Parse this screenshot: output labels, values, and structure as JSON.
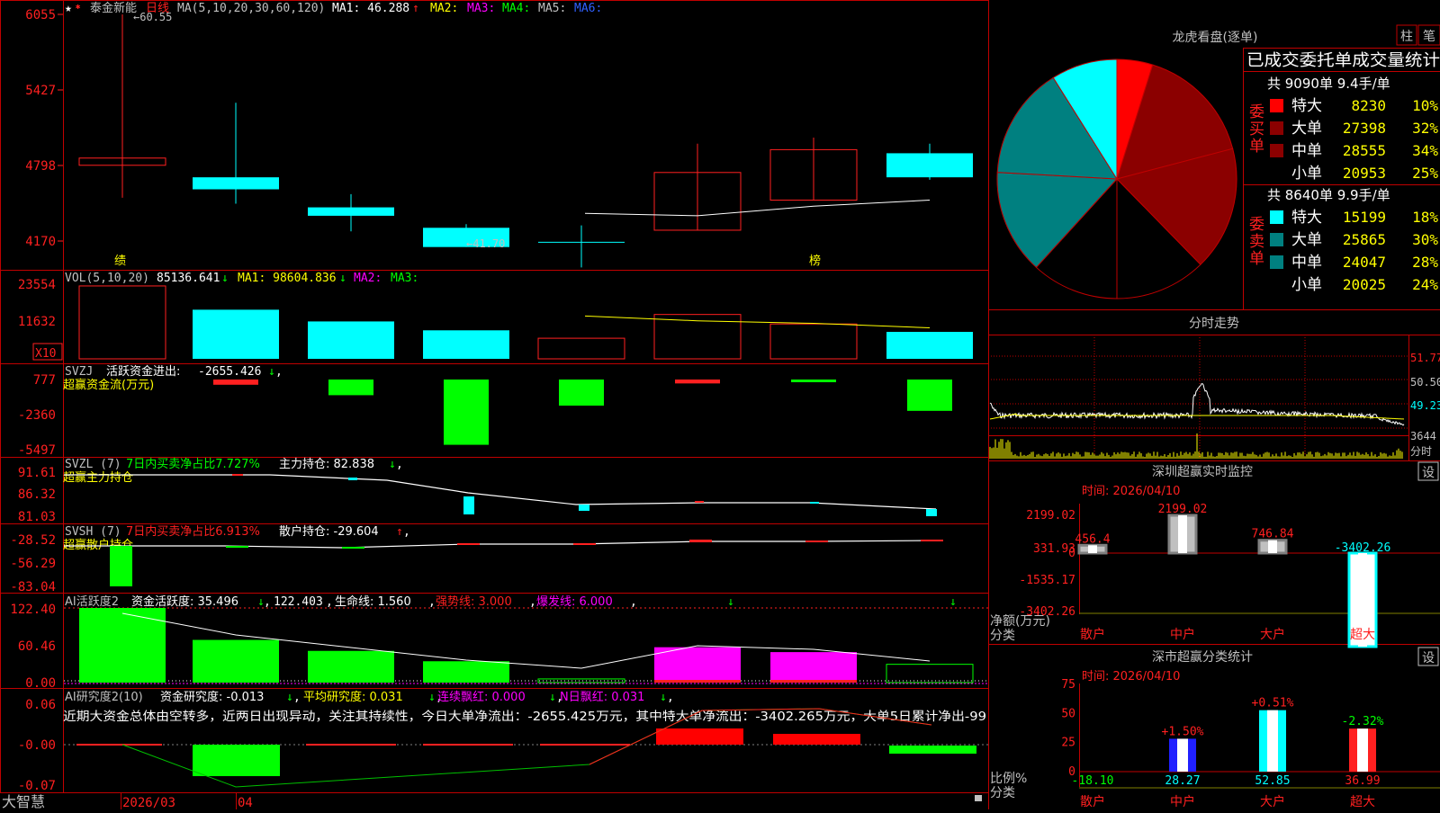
{
  "colors": {
    "up": "#ff2020",
    "down": "#00ffff",
    "green": "#00ff00",
    "magenta": "#ff00ff",
    "yellow": "#ffff00",
    "white": "#ffffff",
    "frame": "#c00000",
    "teal": "#008080",
    "darkred": "#8b0000",
    "navy": "#0000ff"
  },
  "stock": {
    "name": "泰金新能",
    "period": "日线",
    "star_icon": "star-icon",
    "ma_text": "MA(5,10,20,30,60,120)",
    "ma1": "MA1: 46.288",
    "ma1_arrow": "↑",
    "ma2": "MA2:",
    "ma3": "MA3:",
    "ma4": "MA4:",
    "ma5": "MA5:",
    "ma6": "MA6:",
    "high_label": "←60.55",
    "low_label": "←41.70",
    "mark_ji": "绩",
    "mark_bang": "榜"
  },
  "price_axis": [
    "6055",
    "5427",
    "4798",
    "4170"
  ],
  "candles": [
    {
      "open": 48.6,
      "close": 48.0,
      "high": 60.55,
      "low": 45.3
    },
    {
      "open": 47.0,
      "close": 46.0,
      "high": 53.2,
      "low": 44.8
    },
    {
      "open": 44.5,
      "close": 43.8,
      "high": 45.6,
      "low": 42.5
    },
    {
      "open": 42.8,
      "close": 41.2,
      "high": 43.1,
      "low": 41.7
    },
    {
      "open": 41.6,
      "close": 41.6,
      "high": 43.0,
      "low": 39.5
    },
    {
      "open": 42.6,
      "close": 47.4,
      "high": 49.8,
      "low": 42.6
    },
    {
      "open": 45.1,
      "close": 49.3,
      "high": 50.3,
      "low": 45.1
    },
    {
      "open": 49.0,
      "close": 47.0,
      "high": 49.8,
      "low": 46.8
    }
  ],
  "ma1_line": [
    null,
    null,
    null,
    null,
    44.0,
    43.8,
    44.6,
    45.1
  ],
  "vol": {
    "title": "VOL(5,10,20)",
    "value": "85136.641",
    "value_arrow": "↓",
    "ma1": "MA1: 98604.836",
    "ma1_arrow": "↓",
    "ma2": "MA2:",
    "ma3": "MA3:",
    "axis": [
      "23554",
      "11632"
    ],
    "unit": "X10",
    "bars": [
      23000,
      15500,
      11800,
      9000,
      6500,
      14000,
      11000,
      8500
    ],
    "up": [
      true,
      false,
      false,
      false,
      true,
      true,
      true,
      false
    ],
    "ma_line": [
      null,
      null,
      null,
      null,
      13500,
      12000,
      11200,
      9800
    ]
  },
  "svzj": {
    "title": "SVZJ",
    "label": "活跃资金进出:",
    "value": "-2655.426",
    "arrow": "↓",
    "sub": "超赢资金流(万元)",
    "axis": [
      "777",
      "-2360",
      "-5497"
    ],
    "bars": [
      -400,
      -1200,
      -5000,
      -2000,
      -300,
      -200,
      -2400
    ],
    "red": [
      true,
      false,
      false,
      false,
      true,
      false,
      false
    ]
  },
  "svzl": {
    "title": "SVZL (7)",
    "label1": "7日内买卖净占比7.727%",
    "label2": "主力持仓: 82.838",
    "arrow": "↓",
    "sub": "超赢主力持仓",
    "axis": [
      "91.61",
      "86.32",
      "81.03"
    ]
  },
  "svsh": {
    "title": "SVSH (7)",
    "label1": "7日内买卖净占比6.913%",
    "label2": "散户持仓: -29.604",
    "arrow": "↑",
    "sub": "超赢散户持仓",
    "axis": [
      "-28.52",
      "-56.29",
      "-83.04"
    ]
  },
  "ai": {
    "title": "AI活跃度2",
    "label1": "资金活跃度: 35.496",
    "a1": "↓",
    "label2": "122.403",
    "label3": "生命线: 1.560",
    "label4": "强势线: 3.000",
    "label5": "爆发线: 6.000",
    "axis": [
      "122.40",
      "60.46",
      "0.00"
    ],
    "bars": [
      122.4,
      70,
      52,
      35,
      6,
      58,
      50,
      30
    ],
    "colors": [
      "green",
      "green",
      "green",
      "green",
      "outline",
      "magenta",
      "magenta",
      "outline"
    ]
  },
  "research": {
    "title": "AI研究度2(10)",
    "label1": "资金研究度: -0.013",
    "a1": "↓",
    "label2": "平均研究度: 0.031",
    "a2": "↓",
    "label3": "连续飘红: 0.000",
    "a3": "↓",
    "label4": "N日飘红: 0.031",
    "a4": "↓",
    "comment": "近期大资金总体由空转多，近两日出现异动，关注其持续性，今日大单净流出：-2655.425万元，其中特大单净流出：-3402.265万元，大单5日累计净出-99",
    "axis": [
      "0.06",
      "-0.00",
      "-0.07"
    ]
  },
  "dates": {
    "brand": "大智慧",
    "d1": "2026/03",
    "d2": "04"
  },
  "longhu": {
    "title": "龙虎看盘(逐单)",
    "btn_bar": "柱",
    "btn_pen": "笔",
    "stats_title": "已成交委托单成交量统计",
    "buy_side": "委买单",
    "sell_side": "委卖单",
    "buy_total": "共 9090单 9.4手/单",
    "sell_total": "共 8640单 9.9手/单",
    "buy_rows": [
      {
        "name": "特大",
        "vol": "8230",
        "pct": "10%",
        "color": "#ff0000"
      },
      {
        "name": "大单",
        "vol": "27398",
        "pct": "32%",
        "color": "#8b0000"
      },
      {
        "name": "中单",
        "vol": "28555",
        "pct": "34%",
        "color": "#8b0000"
      },
      {
        "name": "小单",
        "vol": "20953",
        "pct": "25%",
        "color": "#000000"
      }
    ],
    "sell_rows": [
      {
        "name": "特大",
        "vol": "15199",
        "pct": "18%",
        "color": "#00ffff"
      },
      {
        "name": "大单",
        "vol": "25865",
        "pct": "30%",
        "color": "#008080"
      },
      {
        "name": "中单",
        "vol": "24047",
        "pct": "28%",
        "color": "#008080"
      },
      {
        "name": "小单",
        "vol": "20025",
        "pct": "24%",
        "color": "#000000"
      }
    ],
    "pie": [
      {
        "v": 8230,
        "c": "#ff0000"
      },
      {
        "v": 27398,
        "c": "#8b0000"
      },
      {
        "v": 28555,
        "c": "#8b0000"
      },
      {
        "v": 20953,
        "c": "#000000"
      },
      {
        "v": 20025,
        "c": "#000000"
      },
      {
        "v": 24047,
        "c": "#008080"
      },
      {
        "v": 25865,
        "c": "#008080"
      },
      {
        "v": 15199,
        "c": "#00ffff"
      }
    ]
  },
  "intraday": {
    "title": "分时走势",
    "axis": [
      "51.77",
      "50.50",
      "49.23"
    ],
    "vol": "3644",
    "unit": "分时"
  },
  "monitor": {
    "title": "深圳超赢实时监控",
    "btn": "设",
    "time": "时间: 2026/04/10",
    "axis": [
      "2199.02",
      "331.93",
      "0",
      "-1535.17",
      "-3402.26"
    ],
    "ylabel": "净额(万元)",
    "xlabel": "分类",
    "cats": [
      "散户",
      "中户",
      "大户",
      "超大"
    ],
    "values": [
      456.4,
      2199.02,
      746.84,
      -3402.26
    ],
    "labels": [
      "456.4",
      "2199.02",
      "746.84",
      "-3402.26"
    ]
  },
  "classify": {
    "title": "深市超赢分类统计",
    "btn": "设",
    "time": "时间: 2026/04/10",
    "axis": [
      "75",
      "50",
      "25",
      "0"
    ],
    "ylabel": "比例%",
    "xlabel": "分类",
    "cats": [
      "散户",
      "中户",
      "大户",
      "超大"
    ],
    "values": [
      0,
      28.27,
      52.85,
      36.99
    ],
    "labels": [
      "-18.10",
      "28.27",
      "52.85",
      "36.99"
    ],
    "deltas": [
      "",
      "+1.50%",
      "+0.51%",
      "-2.32%"
    ]
  }
}
